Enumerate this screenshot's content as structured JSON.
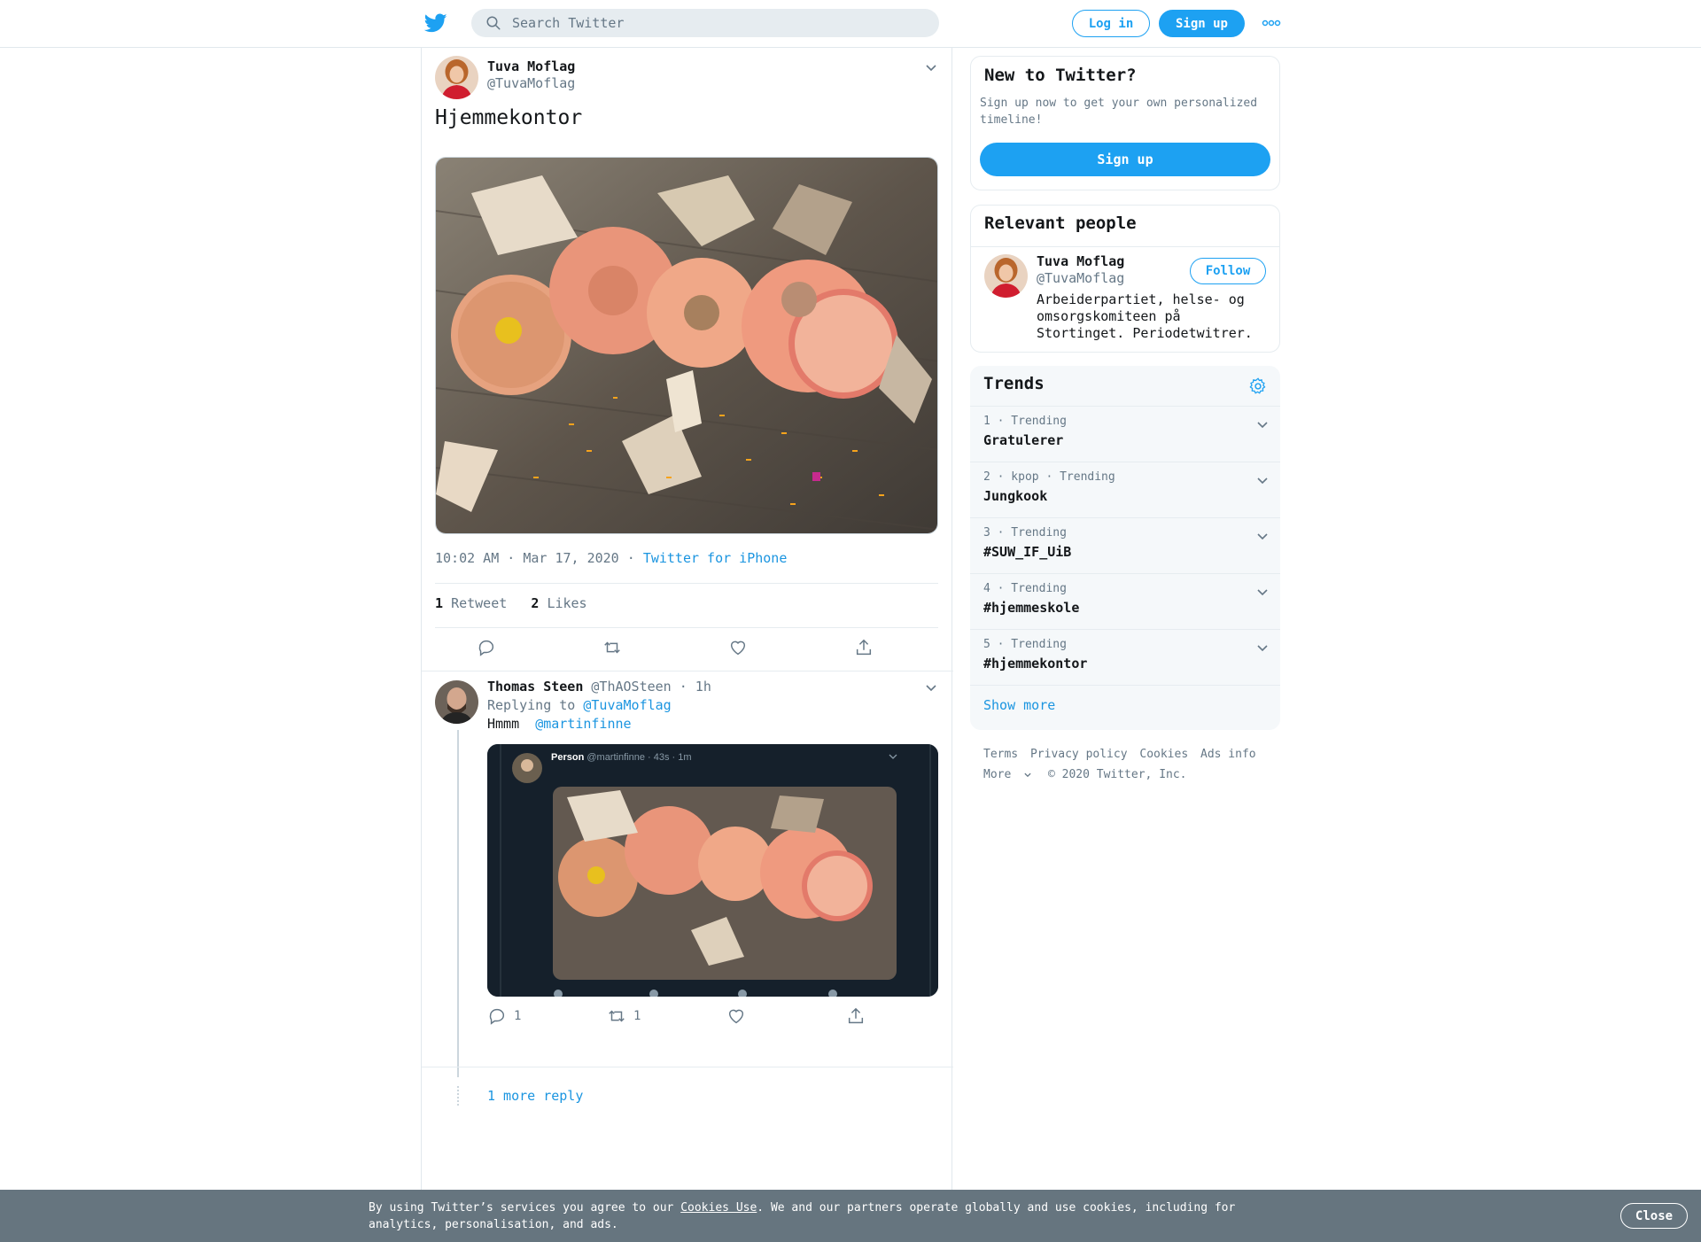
{
  "header": {
    "search_placeholder": "Search Twitter",
    "login_label": "Log in",
    "signup_label": "Sign up",
    "brand_color": "#1DA1F2"
  },
  "tweet": {
    "author_name": "Tuva Moflag",
    "author_handle": "@TuvaMoflag",
    "text": "Hjemmekontor",
    "timestamp": "10:02 AM · Mar 17, 2020",
    "separator": "·",
    "source": "Twitter for iPhone",
    "retweet_count": "1",
    "retweet_label": "Retweet",
    "like_count": "2",
    "like_label": "Likes"
  },
  "reply": {
    "author_name": "Thomas Steen",
    "author_handle": "@ThAOSteen",
    "time": "· 1h",
    "replying_prefix": "Replying to",
    "replying_handle": "@TuvaMoflag",
    "text": "Hmmm",
    "mention": "@martinfinne",
    "embedded": {
      "author_name": "Person",
      "meta": "@martinfinne · 43s · 1m"
    },
    "reply_count": "1",
    "retweet_count": "1",
    "more_replies": "1 more reply"
  },
  "sidebar": {
    "new_to_twitter": {
      "title": "New to Twitter?",
      "subtitle": "Sign up now to get your own personalized timeline!",
      "signup_label": "Sign up"
    },
    "relevant_people": {
      "title": "Relevant people",
      "name": "Tuva Moflag",
      "handle": "@TuvaMoflag",
      "follow_label": "Follow",
      "bio": "Arbeiderpartiet, helse- og omsorgskomiteen på Stortinget. Periodetwitrer."
    },
    "trends": {
      "title": "Trends",
      "items": [
        {
          "meta": "1 · Trending",
          "name": "Gratulerer"
        },
        {
          "meta": "2 · kpop · Trending",
          "name": "Jungkook"
        },
        {
          "meta": "3 · Trending",
          "name": "#SUW_IF_UiB"
        },
        {
          "meta": "4 · Trending",
          "name": "#hjemmeskole"
        },
        {
          "meta": "5 · Trending",
          "name": "#hjemmekontor"
        }
      ],
      "show_more": "Show more"
    },
    "footer": {
      "terms": "Terms",
      "privacy": "Privacy policy",
      "cookies": "Cookies",
      "ads": "Ads info",
      "more": "More",
      "copyright": "© 2020 Twitter, Inc."
    }
  },
  "cookie_bar": {
    "text_before": "By using Twitter’s services you agree to our",
    "link": "Cookies Use",
    "text_after": ". We and our partners operate globally and use cookies, including for analytics, personalisation, and ads.",
    "close_label": "Close"
  }
}
